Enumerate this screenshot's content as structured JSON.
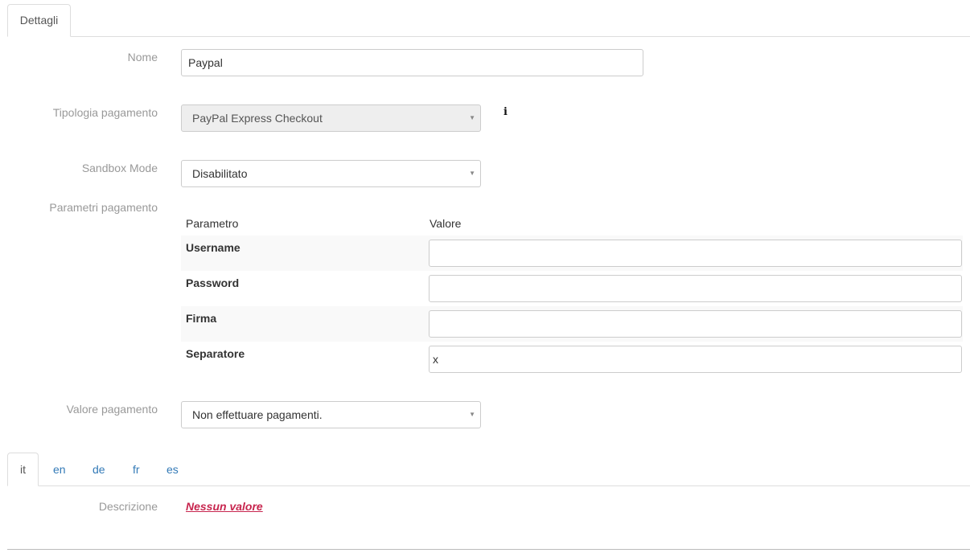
{
  "tabs": {
    "details": "Dettagli"
  },
  "form": {
    "name": {
      "label": "Nome",
      "value": "Paypal"
    },
    "payment_type": {
      "label": "Tipologia pagamento",
      "value": "PayPal Express Checkout"
    },
    "sandbox": {
      "label": "Sandbox Mode",
      "value": "Disabilitato"
    },
    "params": {
      "label": "Parametri pagamento",
      "col_param": "Parametro",
      "col_value": "Valore",
      "rows": [
        {
          "name": "Username",
          "value": ""
        },
        {
          "name": "Password",
          "value": ""
        },
        {
          "name": "Firma",
          "value": ""
        },
        {
          "name": "Separatore",
          "value": "x"
        }
      ]
    },
    "payment_value": {
      "label": "Valore pagamento",
      "value": "Non effettuare pagamenti."
    }
  },
  "langs": [
    "it",
    "en",
    "de",
    "fr",
    "es"
  ],
  "description": {
    "label": "Descrizione",
    "value": "Nessun valore"
  },
  "icons": {
    "info": "info-icon",
    "caret": "caret-down-icon"
  },
  "colors": {
    "link": "#337ab7",
    "empty_value": "#c7254e",
    "label": "#999999"
  }
}
